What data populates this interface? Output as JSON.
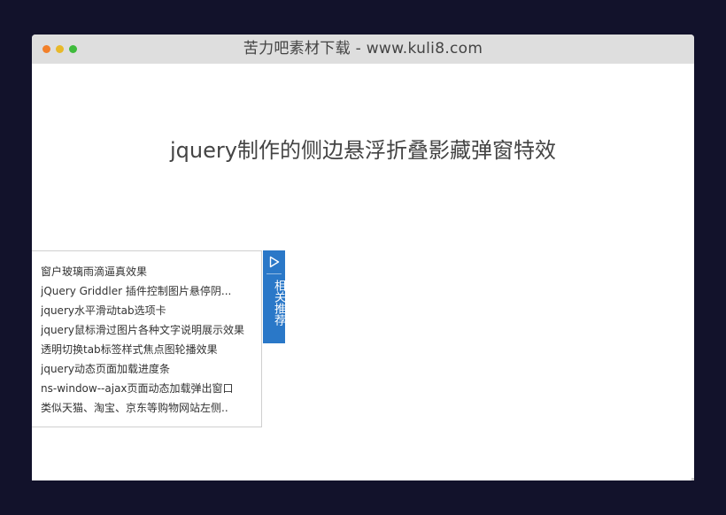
{
  "window": {
    "title": "苦力吧素材下载 - www.kuli8.com",
    "controls": {
      "close_color": "#f2802b",
      "minimize_color": "#e8b92a",
      "maximize_color": "#3fbb3c"
    }
  },
  "page": {
    "heading": "jquery制作的侧边悬浮折叠影藏弹窗特效"
  },
  "sidebar": {
    "tab_label": "相关推荐",
    "tab_color": "#2a78c8",
    "toggle_icon": "play-triangle-icon",
    "links": [
      "窗户玻璃雨滴逼真效果",
      "jQuery Griddler 插件控制图片悬停阴...",
      "jquery水平滑动tab选项卡",
      "jquery鼠标滑过图片各种文字说明展示效果",
      "透明切换tab标签样式焦点图轮播效果",
      "jquery动态页面加载进度条",
      "ns-window--ajax页面动态加载弹出窗口",
      "类似天猫、淘宝、京东等购物网站左侧.."
    ]
  }
}
